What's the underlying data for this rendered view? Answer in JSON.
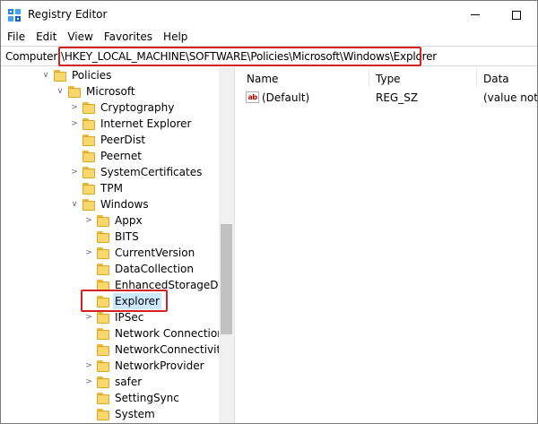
{
  "window": {
    "title": "Registry Editor"
  },
  "menu": [
    "File",
    "Edit",
    "View",
    "Favorites",
    "Help"
  ],
  "address": {
    "label": "Computer",
    "path": "\\HKEY_LOCAL_MACHINE\\SOFTWARE\\Policies\\Microsoft\\Windows\\Explorer"
  },
  "tree": [
    {
      "label": "Policies",
      "expander": "expanded"
    },
    {
      "label": "Microsoft",
      "expander": "expanded"
    },
    {
      "label": "Cryptography",
      "expander": "collapsed"
    },
    {
      "label": "Internet Explorer",
      "expander": "collapsed"
    },
    {
      "label": "PeerDist",
      "expander": "none"
    },
    {
      "label": "Peernet",
      "expander": "none"
    },
    {
      "label": "SystemCertificates",
      "expander": "collapsed"
    },
    {
      "label": "TPM",
      "expander": "none"
    },
    {
      "label": "Windows",
      "expander": "expanded"
    },
    {
      "label": "Appx",
      "expander": "collapsed"
    },
    {
      "label": "BITS",
      "expander": "none"
    },
    {
      "label": "CurrentVersion",
      "expander": "collapsed"
    },
    {
      "label": "DataCollection",
      "expander": "none"
    },
    {
      "label": "EnhancedStorageDevi",
      "expander": "none"
    },
    {
      "label": "Explorer",
      "expander": "none",
      "selected": true
    },
    {
      "label": "IPSec",
      "expander": "collapsed"
    },
    {
      "label": "Network Connections",
      "expander": "none"
    },
    {
      "label": "NetworkConnectivityS",
      "expander": "none"
    },
    {
      "label": "NetworkProvider",
      "expander": "collapsed"
    },
    {
      "label": "safer",
      "expander": "collapsed"
    },
    {
      "label": "SettingSync",
      "expander": "none"
    },
    {
      "label": "System",
      "expander": "none"
    }
  ],
  "values_pane": {
    "columns": [
      "Name",
      "Type",
      "Data"
    ],
    "rows": [
      {
        "icon": "string-value-icon",
        "icon_text": "ab",
        "name": "(Default)",
        "type": "REG_SZ",
        "data": "(value not s"
      }
    ]
  },
  "colors": {
    "highlight_border": "#d32222",
    "selection_bg": "#cce8ff",
    "folder": "#f7d76e"
  }
}
